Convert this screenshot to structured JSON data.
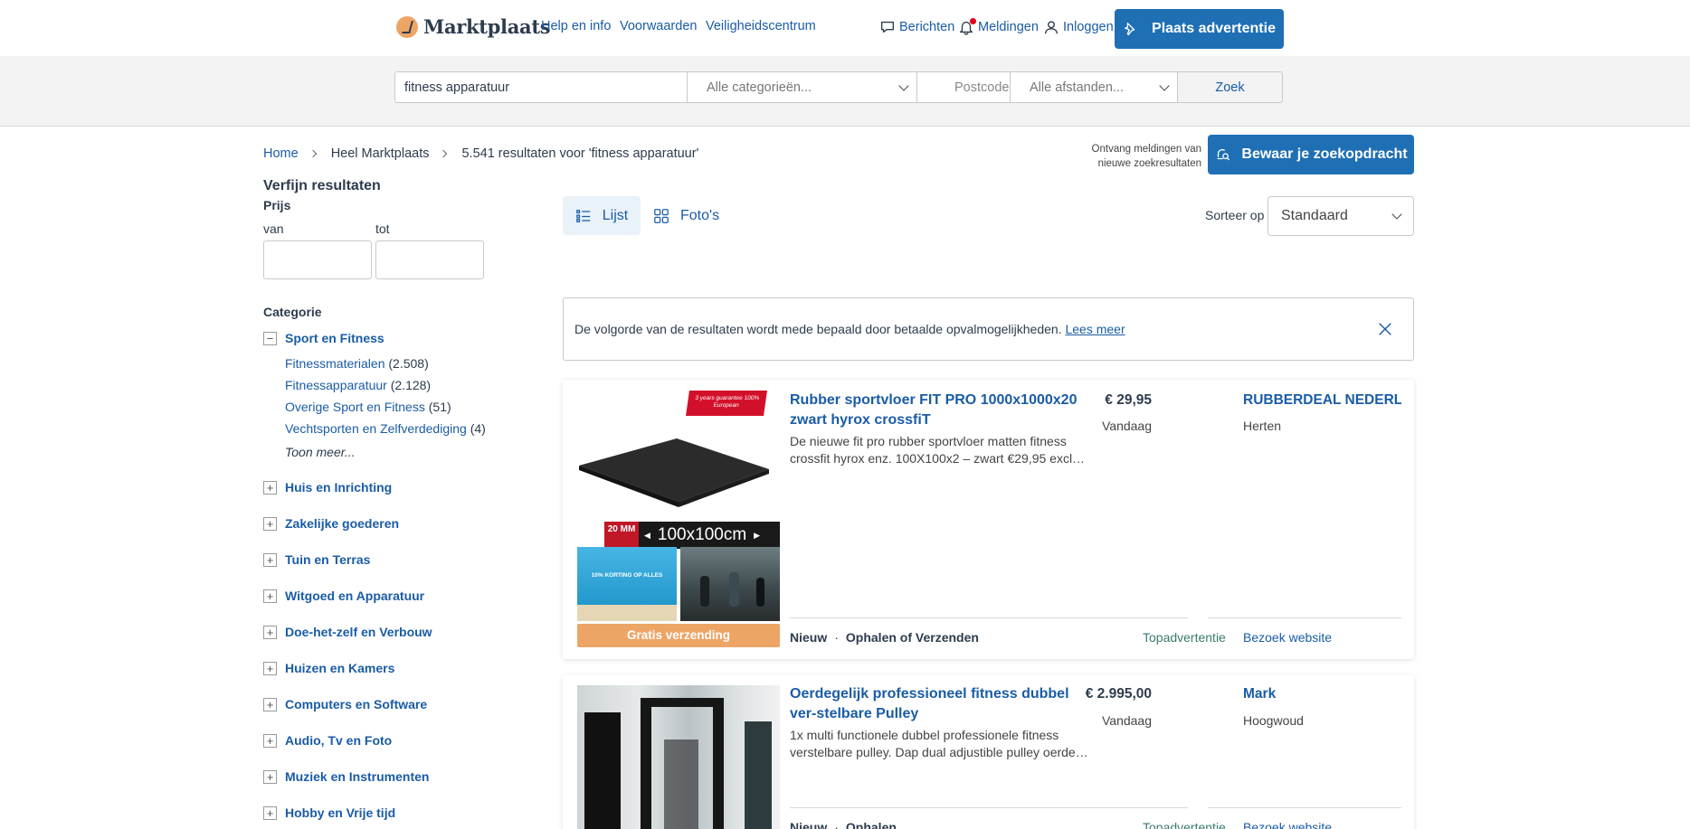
{
  "header": {
    "logo_text": "Marktplaats",
    "links": [
      "Help en info",
      "Voorwaarden",
      "Veiligheidscentrum"
    ],
    "messages_label": "Berichten",
    "notifications_label": "Meldingen",
    "login_label": "Inloggen",
    "place_ad_label": "Plaats advertentie"
  },
  "search": {
    "query": "fitness apparatuur",
    "category": "Alle categorieën...",
    "postcode_placeholder": "Postcode",
    "distance": "Alle afstanden...",
    "submit_label": "Zoek"
  },
  "breadcrumb": {
    "home": "Home",
    "scope": "Heel Marktplaats",
    "results": "5.541 resultaten voor 'fitness apparatuur'"
  },
  "save_search": {
    "hint": "Ontvang meldingen van nieuwe zoekresultaten",
    "button_label": "Bewaar je zoekopdracht"
  },
  "sidebar": {
    "title": "Verfijn resultaten",
    "price_label": "Prijs",
    "from_label": "van",
    "to_label": "tot",
    "category_label": "Categorie",
    "expanded_category": "Sport en Fitness",
    "subcategories": [
      {
        "name": "Fitnessmaterialen",
        "count": "(2.508)"
      },
      {
        "name": "Fitnessapparatuur",
        "count": "(2.128)"
      },
      {
        "name": "Overige Sport en Fitness",
        "count": "(51)"
      },
      {
        "name": "Vechtsporten en Zelfverdediging",
        "count": "(4)"
      }
    ],
    "show_more": "Toon meer...",
    "categories": [
      "Huis en Inrichting",
      "Zakelijke goederen",
      "Tuin en Terras",
      "Witgoed en Apparatuur",
      "Doe-het-zelf en Verbouw",
      "Huizen en Kamers",
      "Computers en Software",
      "Audio, Tv en Foto",
      "Muziek en Instrumenten",
      "Hobby en Vrije tijd"
    ]
  },
  "view": {
    "list_label": "Lijst",
    "photos_label": "Foto's",
    "sort_label": "Sorteer op",
    "sort_value": "Standaard"
  },
  "notice": {
    "text": "De volgorde van de resultaten wordt mede bepaald door betaalde opvalmogelijkheden.",
    "link": "Lees meer"
  },
  "listings": [
    {
      "title": "Rubber sportvloer FIT PRO 1000x1000x20 zwart hyrox crossfiT",
      "description": "De nieuwe fit pro rubber sportvloer matten fitness crossfit hyrox enz. 100X100x2 – zwart €29,95 excl…",
      "price": "€ 29,95",
      "date": "Vandaag",
      "seller": "RUBBERDEAL NEDERLA",
      "location": "Herten",
      "condition": "Nieuw",
      "delivery": "Ophalen of Verzenden",
      "top_ad": "Topadvertentie",
      "visit": "Bezoek website",
      "shipping_badge": "Gratis verzending",
      "badge_text": "3 years guarantee 100% European",
      "image_banner_size": "100x100cm",
      "image_banner_mm": "20 MM",
      "thumb_text": "10% KORTING OP ALLES"
    },
    {
      "title": "Oerdegelijk professioneel fitness dubbel ver-stelbare Pulley",
      "description": "1x multi functionele dubbel professionele fitness verstelbare pulley. Dap dual adjustible pulley oerde…",
      "price": "€ 2.995,00",
      "date": "Vandaag",
      "seller": "Mark",
      "location": "Hoogwoud",
      "condition": "Nieuw",
      "delivery": "Ophalen",
      "top_ad": "Topadvertentie",
      "visit": "Bezoek website"
    }
  ],
  "colors": {
    "brand_blue": "#1f6fb5",
    "link_blue": "#1a5ca6",
    "accent_orange": "#eda566",
    "text": "#2d3c4d"
  }
}
